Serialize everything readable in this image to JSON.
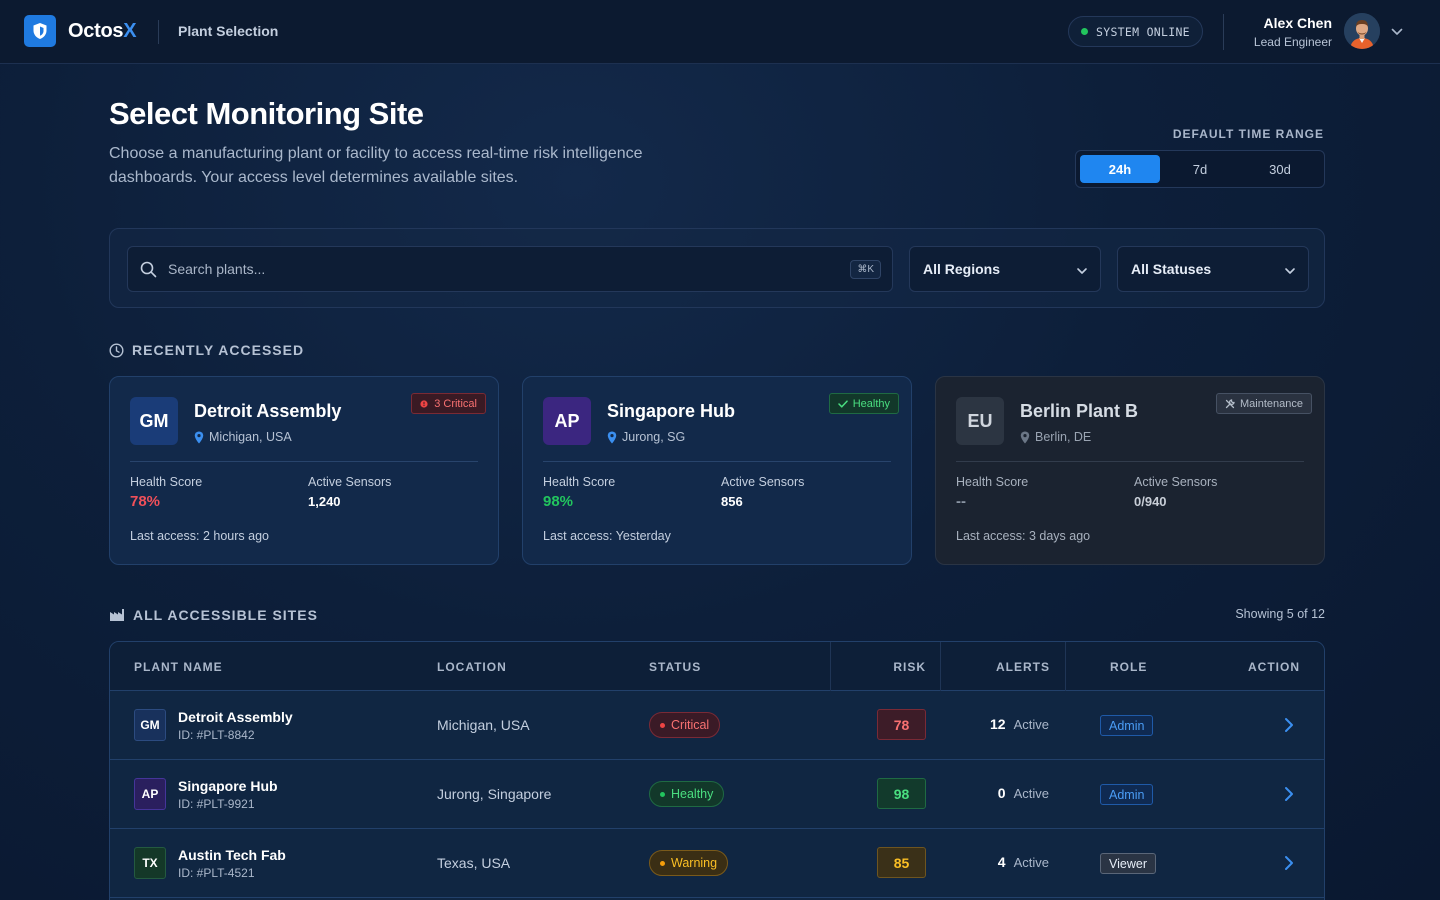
{
  "header": {
    "brand_main": "Octos",
    "brand_accent": "X",
    "breadcrumb": "Plant Selection",
    "system_status": "SYSTEM ONLINE",
    "user_name": "Alex Chen",
    "user_role": "Lead Engineer"
  },
  "page": {
    "title": "Select Monitoring Site",
    "subtitle": "Choose a manufacturing plant or facility to access real-time risk intelligence dashboards. Your access level determines available sites."
  },
  "time_range": {
    "label": "DEFAULT TIME RANGE",
    "options": [
      "24h",
      "7d",
      "30d"
    ],
    "selected": "24h"
  },
  "filters": {
    "search_placeholder": "Search plants...",
    "search_shortcut": "⌘K",
    "region": "All Regions",
    "status": "All Statuses"
  },
  "recent": {
    "heading": "RECENTLY ACCESSED",
    "health_label": "Health Score",
    "sensors_label": "Active Sensors",
    "cards": [
      {
        "abbr": "GM",
        "name": "Detroit Assembly",
        "location": "Michigan, USA",
        "badge": "3 Critical",
        "health": "78%",
        "sensors": "1,240",
        "last_access": "Last access: 2 hours ago"
      },
      {
        "abbr": "AP",
        "name": "Singapore Hub",
        "location": "Jurong, SG",
        "badge": "Healthy",
        "health": "98%",
        "sensors": "856",
        "last_access": "Last access: Yesterday"
      },
      {
        "abbr": "EU",
        "name": "Berlin Plant B",
        "location": "Berlin, DE",
        "badge": "Maintenance",
        "health": "--",
        "sensors": "0/940",
        "last_access": "Last access: 3 days ago"
      }
    ]
  },
  "sites": {
    "heading": "ALL ACCESSIBLE SITES",
    "showing": "Showing 5 of 12",
    "columns": [
      "PLANT NAME",
      "LOCATION",
      "STATUS",
      "RISK",
      "ALERTS",
      "ROLE",
      "ACTION"
    ],
    "active_label": "Active",
    "rows": [
      {
        "abbr": "GM",
        "name": "Detroit Assembly",
        "id": "ID: #PLT-8842",
        "location": "Michigan, USA",
        "status": "Critical",
        "risk": "78",
        "alerts": "12",
        "role": "Admin"
      },
      {
        "abbr": "AP",
        "name": "Singapore Hub",
        "id": "ID: #PLT-9921",
        "location": "Jurong, Singapore",
        "status": "Healthy",
        "risk": "98",
        "alerts": "0",
        "role": "Admin"
      },
      {
        "abbr": "TX",
        "name": "Austin Tech Fab",
        "id": "ID: #PLT-4521",
        "location": "Texas, USA",
        "status": "Warning",
        "risk": "85",
        "alerts": "4",
        "role": "Viewer"
      }
    ]
  },
  "colors": {
    "accent": "#1f86f0",
    "critical": "#ef4444",
    "healthy": "#22c55e",
    "warning": "#f59e0b"
  }
}
